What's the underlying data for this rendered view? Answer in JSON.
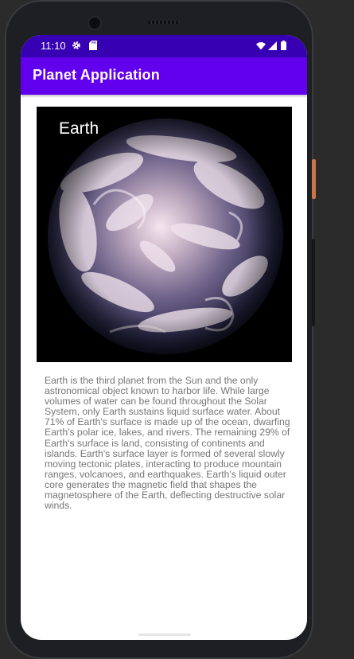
{
  "status_bar": {
    "time": "11:10",
    "left_icons": [
      "gear-icon",
      "sd-card-icon"
    ],
    "right_icons": [
      "wifi-icon",
      "cell-signal-icon",
      "battery-icon"
    ]
  },
  "app_bar": {
    "title": "Planet Application"
  },
  "planet": {
    "name": "Earth",
    "image_icon": "earth-globe-image",
    "description": "Earth is the third planet from the Sun and the only astronomical object known to harbor life. While large volumes of water can be found throughout the Solar System, only Earth sustains liquid surface water. About 71% of Earth's surface is made up of the ocean, dwarfing Earth's polar ice, lakes, and rivers. The remaining 29% of Earth's surface is land, consisting of continents and islands. Earth's surface layer is formed of several slowly moving tectonic plates, interacting to produce mountain ranges, volcanoes, and earthquakes. Earth's liquid outer core generates the magnetic field that shapes the magnetosphere of the Earth, deflecting destructive solar winds."
  },
  "colors": {
    "status_bar": "#3700b3",
    "app_bar": "#6200ee",
    "description_text": "#757575",
    "screen_background": "#ffffff"
  }
}
